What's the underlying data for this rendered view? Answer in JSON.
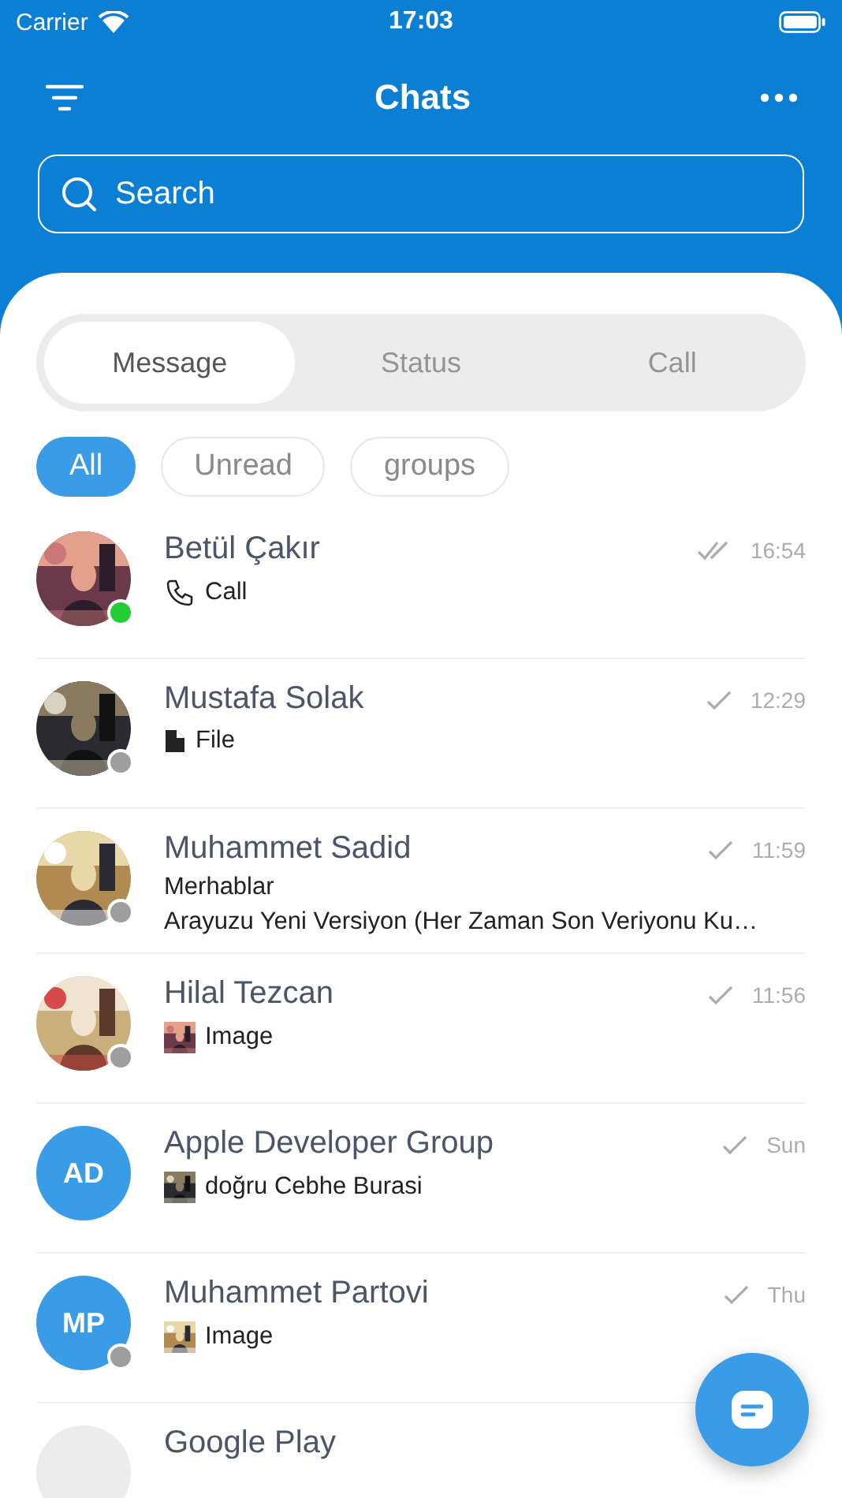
{
  "status_bar": {
    "carrier": "Carrier",
    "time": "17:03"
  },
  "header": {
    "title": "Chats"
  },
  "search": {
    "placeholder": "Search"
  },
  "tabs": [
    {
      "label": "Message",
      "selected": true
    },
    {
      "label": "Status",
      "selected": false
    },
    {
      "label": "Call",
      "selected": false
    }
  ],
  "filters": [
    {
      "label": "All",
      "selected": true
    },
    {
      "label": "Unread",
      "selected": false
    },
    {
      "label": "groups",
      "selected": false
    }
  ],
  "chats": [
    {
      "name": "Betül Çakır",
      "avatar": {
        "kind": "picture"
      },
      "online": true,
      "time": "16:54",
      "read": true,
      "preview": [
        {
          "kind": "call",
          "text": "Call"
        }
      ]
    },
    {
      "name": "Mustafa Solak",
      "avatar": {
        "kind": "picture"
      },
      "online": false,
      "time": "12:29",
      "read": false,
      "preview": [
        {
          "kind": "file",
          "text": "File"
        }
      ]
    },
    {
      "name": "Muhammet Sadid",
      "avatar": {
        "kind": "picture"
      },
      "online": false,
      "time": "11:59",
      "read": false,
      "preview": [
        {
          "kind": "text",
          "text": "Merhablar"
        },
        {
          "kind": "text",
          "text": "Arayuzu Yeni Versiyon (Her Zaman Son Veriyonu Ku…"
        }
      ]
    },
    {
      "name": "Hilal Tezcan",
      "avatar": {
        "kind": "picture"
      },
      "online": false,
      "time": "11:56",
      "read": false,
      "preview": [
        {
          "text": "Image"
        }
      ]
    },
    {
      "name": "Apple Developer Group",
      "avatar": {
        "kind": "initials",
        "text": "AD"
      },
      "time": "Sun",
      "read": false,
      "preview": [
        {
          "text": "doğru Cebhe Burasi"
        }
      ]
    },
    {
      "name": "Muhammet Partovi",
      "avatar": {
        "kind": "initials",
        "text": "MP"
      },
      "online": false,
      "time": "Thu",
      "read": false,
      "preview": [
        {
          "text": "Image"
        }
      ]
    },
    {
      "name": "Google Play",
      "avatar": {
        "kind": "blank"
      }
    }
  ]
}
